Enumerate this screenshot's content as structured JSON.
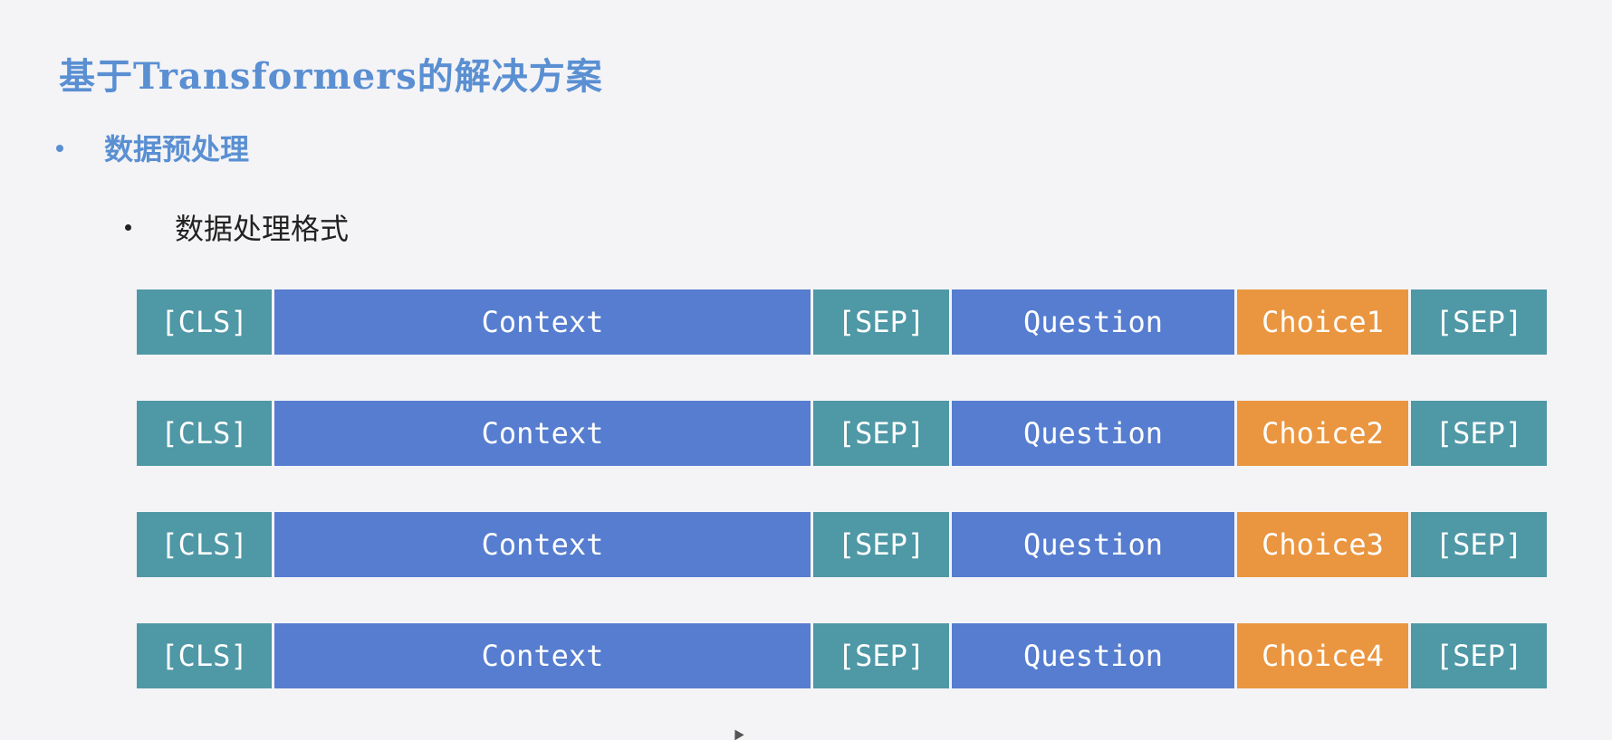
{
  "slide": {
    "title": "基于Transformers的解决方案",
    "bullet_l1": "数据预处理",
    "bullet_l2": "数据处理格式"
  },
  "colors": {
    "title": "#5a8fd2",
    "special_token": "#4f98a6",
    "context_question": "#567dcf",
    "choice": "#ea9640",
    "background": "#f4f4f7"
  },
  "sequences": [
    {
      "cls": "[CLS]",
      "context": "Context",
      "sep1": "[SEP]",
      "question": "Question",
      "choice": "Choice1",
      "sep2": "[SEP]"
    },
    {
      "cls": "[CLS]",
      "context": "Context",
      "sep1": "[SEP]",
      "question": "Question",
      "choice": "Choice2",
      "sep2": "[SEP]"
    },
    {
      "cls": "[CLS]",
      "context": "Context",
      "sep1": "[SEP]",
      "question": "Question",
      "choice": "Choice3",
      "sep2": "[SEP]"
    },
    {
      "cls": "[CLS]",
      "context": "Context",
      "sep1": "[SEP]",
      "question": "Question",
      "choice": "Choice4",
      "sep2": "[SEP]"
    }
  ]
}
